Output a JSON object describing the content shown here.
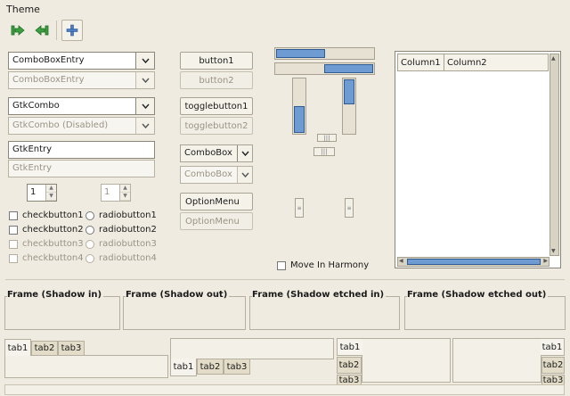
{
  "theme_label": "Theme",
  "toolbar": {
    "back_icon": "go-first-icon",
    "forward_icon": "go-last-icon",
    "add_icon": "add-icon"
  },
  "col1": {
    "combo_entry": "ComboBoxEntry",
    "combo_entry_disabled": "ComboBoxEntry",
    "gtk_combo": "GtkCombo",
    "gtk_combo_disabled": "GtkCombo (Disabled)",
    "gtk_entry": "GtkEntry",
    "gtk_entry_disabled": "GtkEntry",
    "spin1": "1",
    "spin2": "1",
    "check1": "checkbutton1",
    "check2": "checkbutton2",
    "check3": "checkbutton3",
    "check4": "checkbutton4",
    "radio1": "radiobutton1",
    "radio2": "radiobutton2",
    "radio3": "radiobutton3",
    "radio4": "radiobutton4"
  },
  "col2": {
    "button1": "button1",
    "button2": "button2",
    "toggle1": "togglebutton1",
    "toggle2": "togglebutton2",
    "combobox": "ComboBox",
    "combobox_disabled": "ComboBox",
    "option_menu": "OptionMenu",
    "option_menu_disabled": "OptionMenu"
  },
  "scales": {
    "move_in_harmony": "Move In Harmony",
    "hscale_value": 0.4,
    "hscroll_value": 0.6,
    "vscale_value": 0.6,
    "vscroll_value": 0.2
  },
  "tree": {
    "columns": [
      "Column1",
      "Column2"
    ]
  },
  "frames": [
    "Frame (Shadow in)",
    "Frame (Shadow out)",
    "Frame (Shadow etched in)",
    "Frame (Shadow etched out)"
  ],
  "tabs": [
    "tab1",
    "tab2",
    "tab3"
  ],
  "colors": {
    "background": "#efebe0",
    "accent": "#6f9bd3",
    "icon_green": "#3aa040"
  }
}
